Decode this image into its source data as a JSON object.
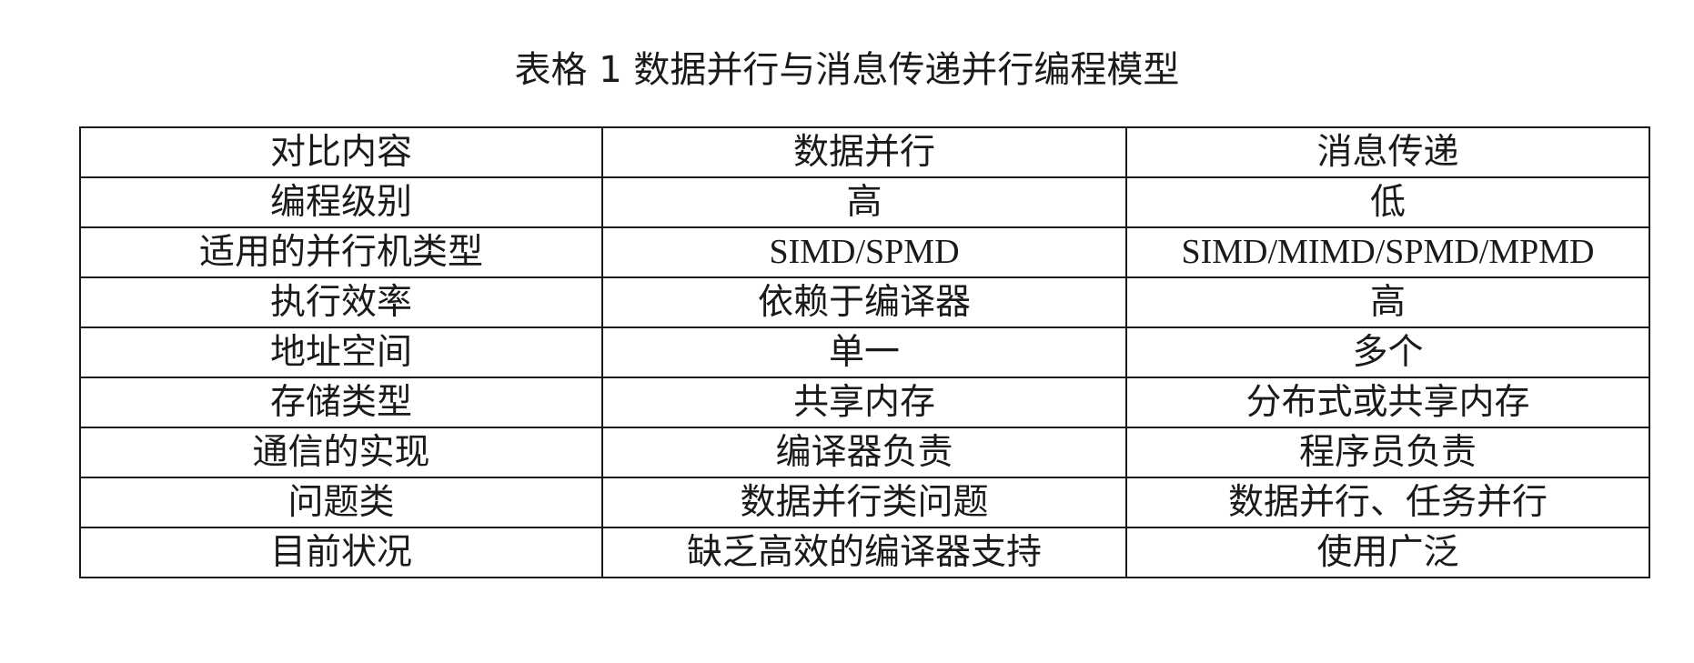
{
  "caption": "表格 1 数据并行与消息传递并行编程模型",
  "table": {
    "header": [
      "对比内容",
      "数据并行",
      "消息传递"
    ],
    "rows": [
      [
        "编程级别",
        "高",
        "低"
      ],
      [
        "适用的并行机类型",
        "SIMD/SPMD",
        "SIMD/MIMD/SPMD/MPMD"
      ],
      [
        "执行效率",
        "依赖于编译器",
        "高"
      ],
      [
        "地址空间",
        "单一",
        "多个"
      ],
      [
        "存储类型",
        "共享内存",
        "分布式或共享内存"
      ],
      [
        "通信的实现",
        "编译器负责",
        "程序员负责"
      ],
      [
        "问题类",
        "数据并行类问题",
        "数据并行、任务并行"
      ],
      [
        "目前状况",
        "缺乏高效的编译器支持",
        "使用广泛"
      ]
    ]
  }
}
